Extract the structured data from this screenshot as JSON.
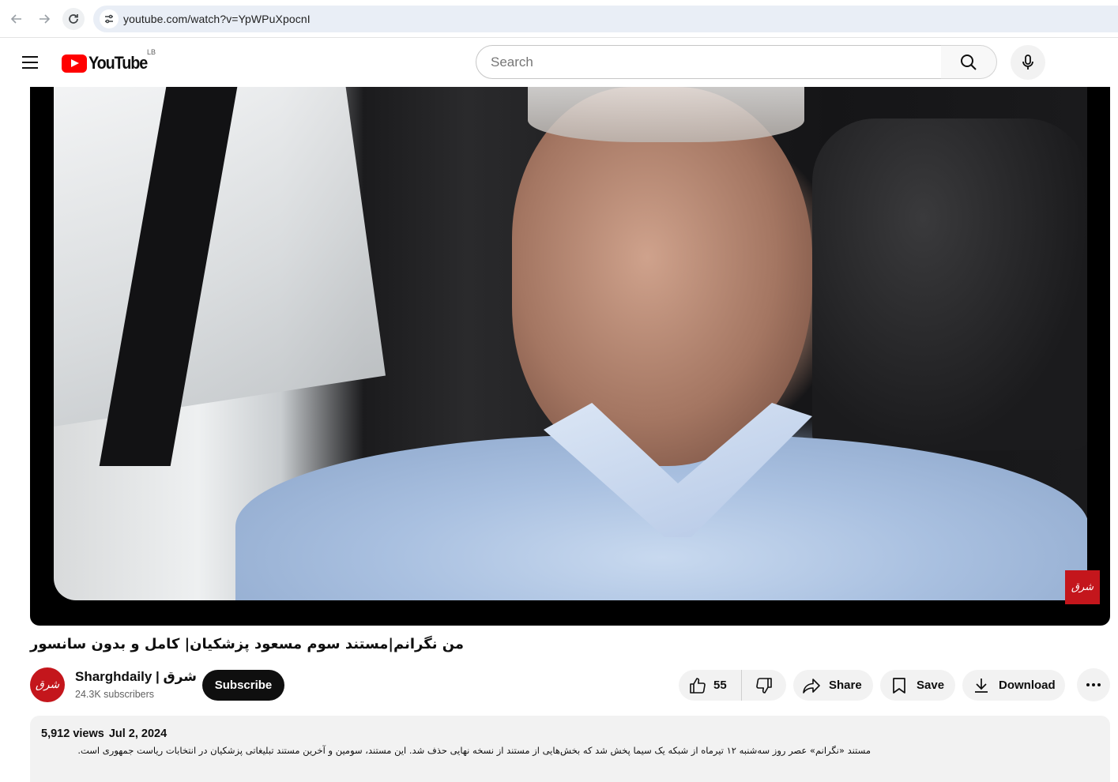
{
  "browser": {
    "url": "youtube.com/watch?v=YpWPuXpocnI"
  },
  "header": {
    "logo_text": "YouTube",
    "country_code": "LB",
    "search_placeholder": "Search"
  },
  "video": {
    "title": "من نگرانم|مستند سوم مسعود پزشکیان| کامل و بدون سانسور",
    "watermark_text": "شرق"
  },
  "channel": {
    "name": "Sharghdaily | شرق",
    "subscribers": "24.3K subscribers",
    "avatar_text": "شرق",
    "subscribe_label": "Subscribe"
  },
  "actions": {
    "like_count": "55",
    "share_label": "Share",
    "save_label": "Save",
    "download_label": "Download"
  },
  "description": {
    "views": "5,912 views",
    "date": "Jul 2, 2024",
    "text": "مستند «نگرانم» عصر روز سه‌شنبه ۱۲ تیرماه از شبکه یک سیما پخش شد که بخش‌هایی از مستند از نسخه نهایی حذف شد. این مستند، سومین و آخرین مستند تبلیغاتی پزشکیان در انتخابات ریاست جمهوری است."
  },
  "colors": {
    "brand_red": "#ff0000",
    "channel_red": "#c4161c",
    "button_gray": "#f2f2f2",
    "subscribe_black": "#0f0f0f"
  }
}
